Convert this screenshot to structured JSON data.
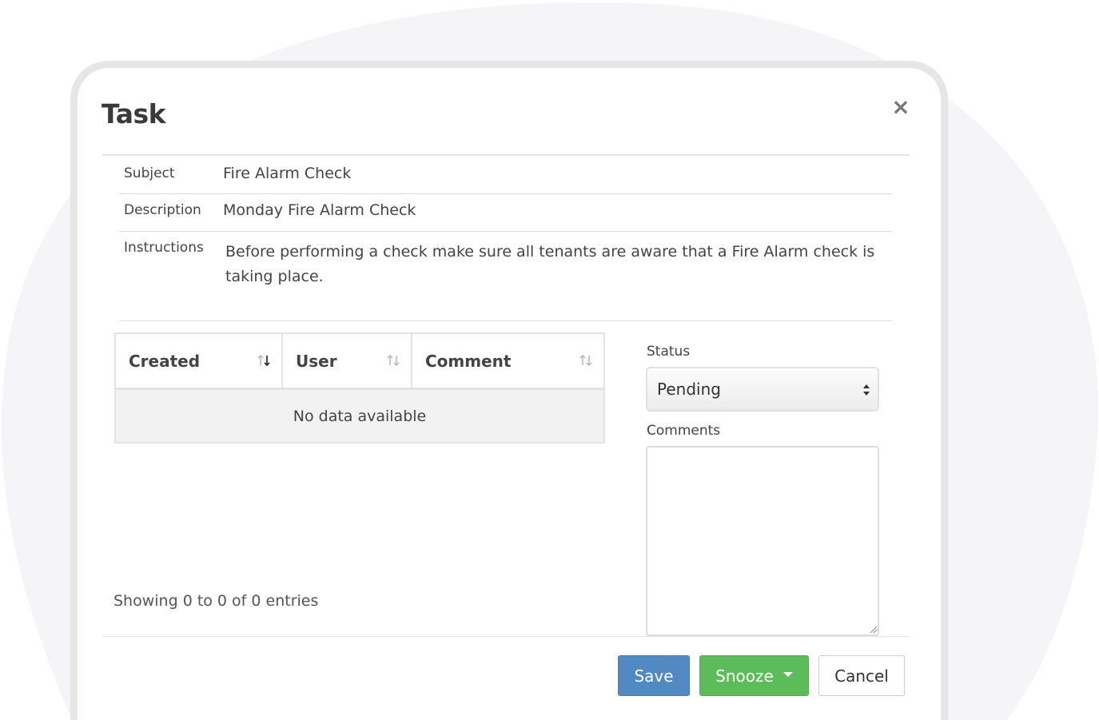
{
  "modal": {
    "title": "Task",
    "close_symbol": "×"
  },
  "details": {
    "subject_label": "Subject",
    "subject_value": "Fire Alarm Check",
    "description_label": "Description",
    "description_value": "Monday Fire Alarm Check",
    "instructions_label": "Instructions",
    "instructions_value": "Before performing a check make sure all tenants are aware that a Fire Alarm check is taking place."
  },
  "table": {
    "columns": [
      "Created",
      "User",
      "Comment"
    ],
    "sort_icons": [
      "sort-desc-icon",
      "sort-both-icon",
      "sort-both-icon"
    ],
    "empty_text": "No data available",
    "info": "Showing 0 to 0 of 0 entries"
  },
  "form": {
    "status_label": "Status",
    "status_value": "Pending",
    "comments_label": "Comments",
    "comments_value": ""
  },
  "footer": {
    "save_label": "Save",
    "snooze_label": "Snooze",
    "cancel_label": "Cancel"
  },
  "colors": {
    "save": "#5189c3",
    "snooze": "#5cbc5a",
    "background_blob": "#f5f5f7",
    "modal_border": "#e6e6e7"
  }
}
